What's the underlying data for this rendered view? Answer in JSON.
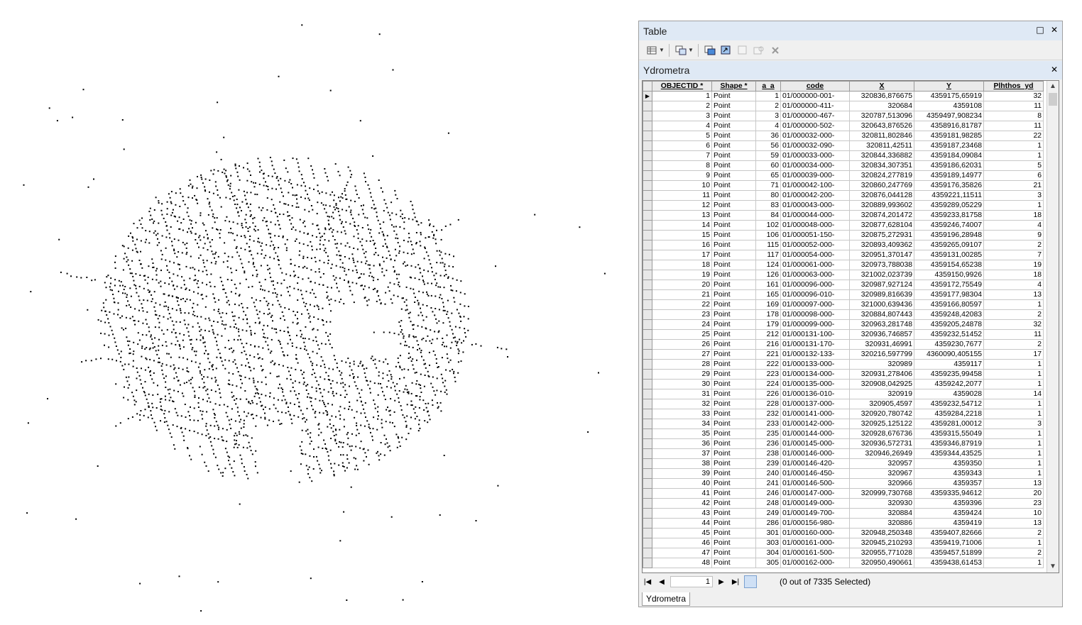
{
  "table_window": {
    "title": "Table",
    "restore_glyph": "□",
    "close_glyph": "✕",
    "layer_name": "Ydrometra",
    "columns": [
      "OBJECTID *",
      "Shape *",
      "a_a",
      "code",
      "X",
      "Y",
      "Plhthos_yd"
    ],
    "rows": [
      [
        "1",
        "Point",
        "1",
        "01/000000-001-",
        "320836,876675",
        "4359175,65919",
        "32"
      ],
      [
        "2",
        "Point",
        "2",
        "01/000000-411-",
        "320684",
        "4359108",
        "11"
      ],
      [
        "3",
        "Point",
        "3",
        "01/000000-467-",
        "320787,513096",
        "4359497,908234",
        "8"
      ],
      [
        "4",
        "Point",
        "4",
        "01/000000-502-",
        "320643,876526",
        "4358916,81787",
        "11"
      ],
      [
        "5",
        "Point",
        "36",
        "01/000032-000-",
        "320811,802846",
        "4359181,98285",
        "22"
      ],
      [
        "6",
        "Point",
        "56",
        "01/000032-090-",
        "320811,42511",
        "4359187,23468",
        "1"
      ],
      [
        "7",
        "Point",
        "59",
        "01/000033-000-",
        "320844,336882",
        "4359184,09084",
        "1"
      ],
      [
        "8",
        "Point",
        "60",
        "01/000034-000-",
        "320834,307351",
        "4359186,62031",
        "5"
      ],
      [
        "9",
        "Point",
        "65",
        "01/000039-000-",
        "320824,277819",
        "4359189,14977",
        "6"
      ],
      [
        "10",
        "Point",
        "71",
        "01/000042-100-",
        "320860,247769",
        "4359176,35826",
        "21"
      ],
      [
        "11",
        "Point",
        "80",
        "01/000042-200-",
        "320876,044128",
        "4359221,11511",
        "3"
      ],
      [
        "12",
        "Point",
        "83",
        "01/000043-000-",
        "320889,993602",
        "4359289,05229",
        "1"
      ],
      [
        "13",
        "Point",
        "84",
        "01/000044-000-",
        "320874,201472",
        "4359233,81758",
        "18"
      ],
      [
        "14",
        "Point",
        "102",
        "01/000048-000-",
        "320877,628104",
        "4359246,74007",
        "4"
      ],
      [
        "15",
        "Point",
        "106",
        "01/000051-150-",
        "320875,272931",
        "4359196,28948",
        "9"
      ],
      [
        "16",
        "Point",
        "115",
        "01/000052-000-",
        "320893,409362",
        "4359265,09107",
        "2"
      ],
      [
        "17",
        "Point",
        "117",
        "01/000054-000-",
        "320951,370147",
        "4359131,00285",
        "7"
      ],
      [
        "18",
        "Point",
        "124",
        "01/000061-000-",
        "320973,788038",
        "4359154,65238",
        "19"
      ],
      [
        "19",
        "Point",
        "126",
        "01/000063-000-",
        "321002,023739",
        "4359150,9926",
        "18"
      ],
      [
        "20",
        "Point",
        "161",
        "01/000096-000-",
        "320987,927124",
        "4359172,75549",
        "4"
      ],
      [
        "21",
        "Point",
        "165",
        "01/000096-010-",
        "320989,816639",
        "4359177,98304",
        "13"
      ],
      [
        "22",
        "Point",
        "169",
        "01/000097-000-",
        "321000,639436",
        "4359166,80597",
        "1"
      ],
      [
        "23",
        "Point",
        "178",
        "01/000098-000-",
        "320884,807443",
        "4359248,42083",
        "2"
      ],
      [
        "24",
        "Point",
        "179",
        "01/000099-000-",
        "320963,281748",
        "4359205,24878",
        "32"
      ],
      [
        "25",
        "Point",
        "212",
        "01/000131-100-",
        "320936,746857",
        "4359232,51452",
        "11"
      ],
      [
        "26",
        "Point",
        "216",
        "01/000131-170-",
        "320931,46991",
        "4359230,7677",
        "2"
      ],
      [
        "27",
        "Point",
        "221",
        "01/000132-133-",
        "320216,597799",
        "4360090,405155",
        "17"
      ],
      [
        "28",
        "Point",
        "222",
        "01/000133-000-",
        "320989",
        "4359117",
        "1"
      ],
      [
        "29",
        "Point",
        "223",
        "01/000134-000-",
        "320931,278406",
        "4359235,99458",
        "1"
      ],
      [
        "30",
        "Point",
        "224",
        "01/000135-000-",
        "320908,042925",
        "4359242,2077",
        "1"
      ],
      [
        "31",
        "Point",
        "226",
        "01/000136-010-",
        "320919",
        "4359028",
        "14"
      ],
      [
        "32",
        "Point",
        "228",
        "01/000137-000-",
        "320905,4597",
        "4359232,54712",
        "1"
      ],
      [
        "33",
        "Point",
        "232",
        "01/000141-000-",
        "320920,780742",
        "4359284,2218",
        "1"
      ],
      [
        "34",
        "Point",
        "233",
        "01/000142-000-",
        "320925,125122",
        "4359281,00012",
        "3"
      ],
      [
        "35",
        "Point",
        "235",
        "01/000144-000-",
        "320928,676736",
        "4359315,55049",
        "1"
      ],
      [
        "36",
        "Point",
        "236",
        "01/000145-000-",
        "320936,572731",
        "4359346,87919",
        "1"
      ],
      [
        "37",
        "Point",
        "238",
        "01/000146-000-",
        "320946,26949",
        "4359344,43525",
        "1"
      ],
      [
        "38",
        "Point",
        "239",
        "01/000146-420-",
        "320957",
        "4359350",
        "1"
      ],
      [
        "39",
        "Point",
        "240",
        "01/000146-450-",
        "320967",
        "4359343",
        "1"
      ],
      [
        "40",
        "Point",
        "241",
        "01/000146-500-",
        "320966",
        "4359357",
        "13"
      ],
      [
        "41",
        "Point",
        "246",
        "01/000147-000-",
        "320999,730768",
        "4359335,94612",
        "20"
      ],
      [
        "42",
        "Point",
        "248",
        "01/000149-000-",
        "320930",
        "4359396",
        "23"
      ],
      [
        "43",
        "Point",
        "249",
        "01/000149-700-",
        "320884",
        "4359424",
        "10"
      ],
      [
        "44",
        "Point",
        "286",
        "01/000156-980-",
        "320886",
        "4359419",
        "13"
      ],
      [
        "45",
        "Point",
        "301",
        "01/000160-000-",
        "320948,250348",
        "4359407,82666",
        "2"
      ],
      [
        "46",
        "Point",
        "303",
        "01/000161-000-",
        "320945,210293",
        "4359419,71006",
        "1"
      ],
      [
        "47",
        "Point",
        "304",
        "01/000161-500-",
        "320955,771028",
        "4359457,51899",
        "2"
      ],
      [
        "48",
        "Point",
        "305",
        "01/000162-000-",
        "320950,490661",
        "4359438,61453",
        "1"
      ]
    ],
    "current_record": "1",
    "selection_status": "(0 out of 7335 Selected)",
    "tab_label": "Ydrometra"
  },
  "icons": {
    "table_options": "table-options-icon",
    "related_tables": "related-tables-icon",
    "select_by_attributes": "select-by-attributes-icon",
    "switch_selection": "switch-selection-icon",
    "clear_selection": "clear-selection-icon",
    "zoom_to_selected": "zoom-to-selected-icon",
    "delete_selected": "delete-selected-icon"
  },
  "colors": {
    "title_bar": "#dfe9f5",
    "point_symbol": "#000000"
  }
}
